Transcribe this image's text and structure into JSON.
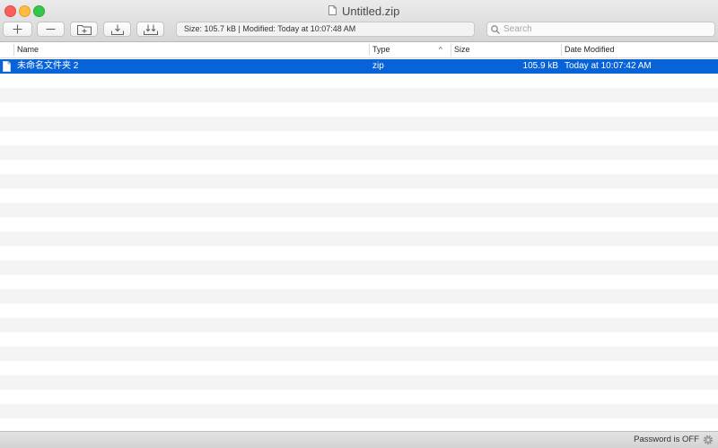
{
  "window": {
    "title": "Untitled.zip"
  },
  "toolbar": {
    "buttons": [
      {
        "name": "add",
        "icon": "plus-icon"
      },
      {
        "name": "remove",
        "icon": "minus-icon"
      },
      {
        "name": "new-folder",
        "icon": "new-folder-icon"
      },
      {
        "name": "extract",
        "icon": "extract-icon"
      },
      {
        "name": "extract-all",
        "icon": "extract-all-icon"
      }
    ],
    "info": "Size: 105.7 kB  |  Modified: Today at 10:07:48 AM"
  },
  "search": {
    "placeholder": "Search",
    "value": ""
  },
  "columns": {
    "name": "Name",
    "type": "Type",
    "sort_indicator": "^",
    "size": "Size",
    "date_modified": "Date Modified"
  },
  "files": [
    {
      "name": "未命名文件夹 2",
      "type": "zip",
      "size": "105.9 kB",
      "date_modified": "Today at 10:07:42 AM",
      "selected": true
    }
  ],
  "status": {
    "password": "Password is OFF"
  },
  "colors": {
    "selection": "#0862d8",
    "stripe": "#f4f4f4",
    "close": "#fc605c",
    "minimize": "#fdbc40",
    "maximize": "#34c84a"
  }
}
